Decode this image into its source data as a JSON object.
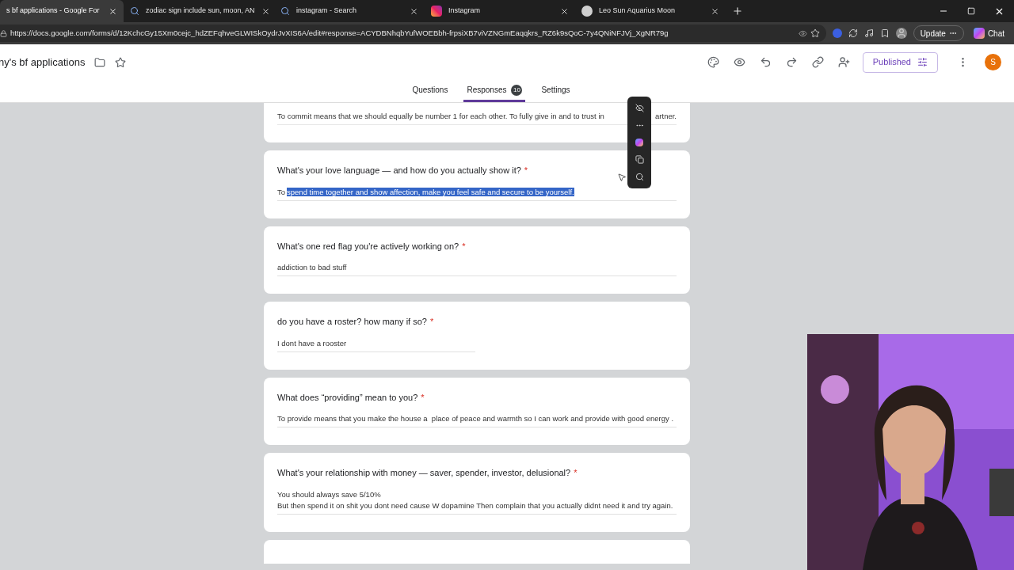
{
  "browser_tabs": [
    {
      "title": "s bf applications - Google For",
      "selected": true
    },
    {
      "title": "zodiac sign include sun, moon, AN",
      "kind": "search",
      "selected": false
    },
    {
      "title": "instagram - Search",
      "kind": "search",
      "selected": false
    },
    {
      "title": "Instagram",
      "kind": "instagram",
      "selected": false
    },
    {
      "title": "Leo Sun Aquarius Moon",
      "kind": "chat",
      "selected": false
    }
  ],
  "address_bar": {
    "url": "https://docs.google.com/forms/d/12KchcGy15Xm0cejc_hdZEFqhveGLWISkOydrJvXIS6A/edit#response=ACYDBNhqbYufWOEBbh-frpsiXB7viVZNGmEaqqkrs_RZ6k9sQoC-7y4QNiNFJVj_XgNR79g"
  },
  "browser_buttons": {
    "update": "Update",
    "chat": "Chat"
  },
  "form_header": {
    "title": "ny's bf applications",
    "publish_button": "Published",
    "avatar": "S"
  },
  "form_tabs": [
    {
      "label": "Questions",
      "selected": false
    },
    {
      "label": "Responses",
      "selected": true,
      "count": "10"
    },
    {
      "label": "Settings",
      "selected": false
    }
  ],
  "answers_top": {
    "before_overlay": "To commit means that we should equally be number 1 for each other. To fully give in and to trust in",
    "after_overlay": "artner."
  },
  "required_mark": "*",
  "questions": [
    {
      "question": "What's your love language — and how do you actually show it?",
      "required": true,
      "answer_prefix": "To",
      "answer_selected": "spend time together and show affection, make you feel safe and secure to be yourself."
    },
    {
      "question": "What's one red flag you're actively working on?",
      "required": true,
      "answer_prefix": "addiction to bad stuff"
    },
    {
      "question": "do you have a roster? how many if so?",
      "required": true,
      "answer_prefix": "I dont have a rooster"
    },
    {
      "question": "What does “providing” mean to you?",
      "required": true,
      "answer_prefix": "To provide means that you make the house a  place of peace and warmth so I can work and provide with good energy ."
    },
    {
      "question": "What's your relationship with money — saver, spender, investor, delusional?",
      "required": true,
      "answer_prefix": "You should always save 5/10%\nBut then spend it on shit you dont need cause W dopamine Then complain that you actually didnt need it and try again."
    }
  ]
}
